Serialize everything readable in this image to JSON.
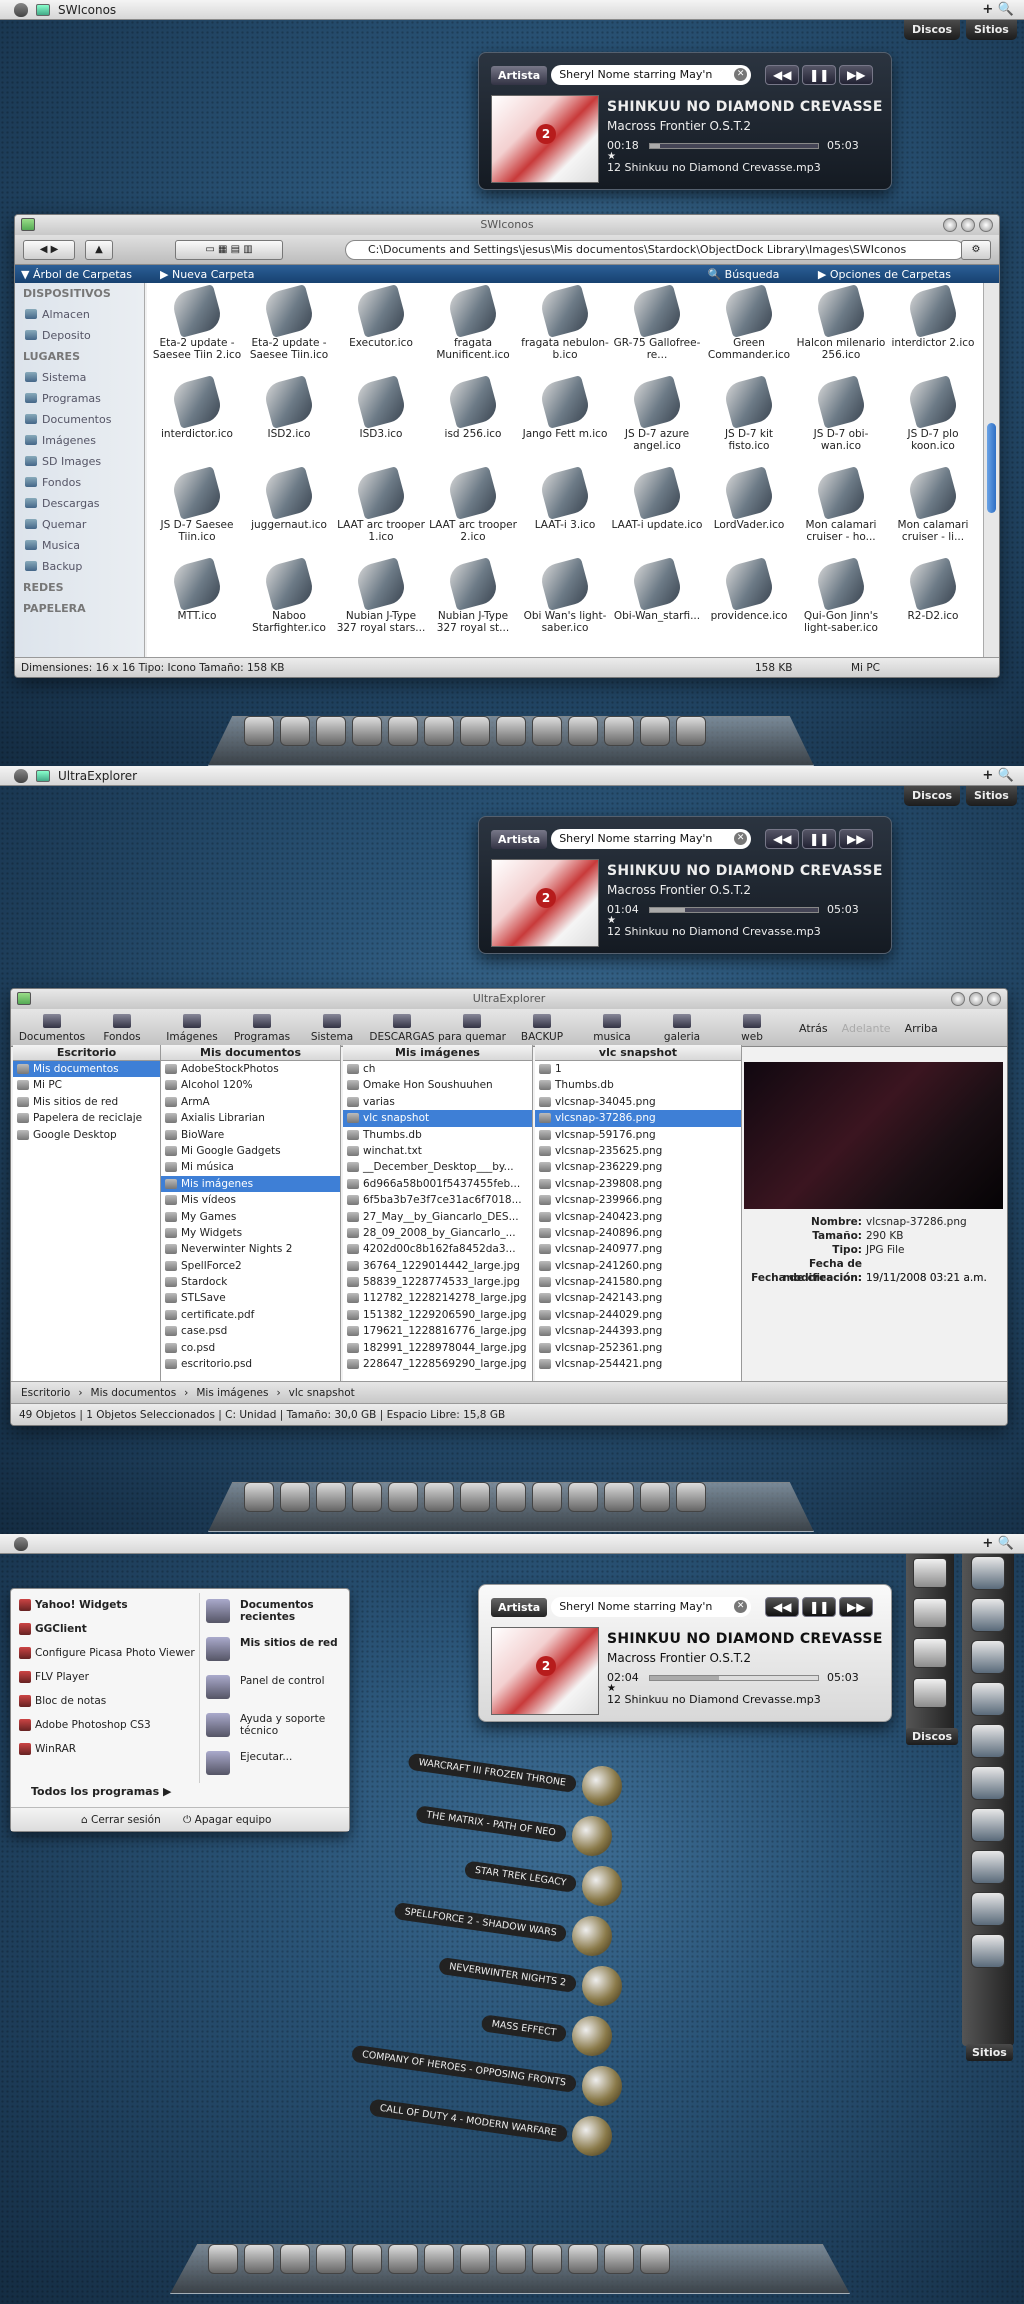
{
  "colors": {
    "accent": "#3e7fd6",
    "ribbon": "#1f4f86",
    "dark_panel": "#1a2029"
  },
  "menubar": {
    "right_icons": "+ 🔍",
    "tab_discos": "Discos",
    "tab_sitios": "Sitios"
  },
  "s1": {
    "title": "SWIconos",
    "player": {
      "artist_btn": "Artista",
      "search": "Sheryl Nome starring May'n",
      "track": "SHINKUU NO DIAMOND CREVASSE",
      "album": "Macross Frontier O.S.T.2",
      "elapsed": "00:18",
      "total": "05:03",
      "progress": 0.06,
      "file": "12 Shinkuu no Diamond Crevasse.mp3"
    },
    "window": {
      "title": "SWIconos",
      "address": "C:\\Documents and Settings\\jesus\\Mis documentos\\Stardock\\ObjectDock Library\\Images\\SWIconos",
      "ribbon": [
        "Árbol de Carpetas",
        "Nueva Carpeta"
      ],
      "ribbon_right": [
        "Búsqueda",
        "Opciones de Carpetas"
      ],
      "sidebar_dispositivos": "DISPOSITIVOS",
      "sidebar_dev": [
        "Almacen",
        "Deposito"
      ],
      "sidebar_lugares": "LUGARES",
      "sidebar_places": [
        "Sistema",
        "Programas",
        "Documentos",
        "Imágenes",
        "SD Images",
        "Fondos",
        "Descargas",
        "Quemar",
        "Musica",
        "Backup"
      ],
      "sidebar_redes": "REDES",
      "sidebar_papelera": "PAPELERA",
      "icons": [
        "Eta-2 update - Saesee Tiin 2.ico",
        "Eta-2 update - Saesee Tiin.ico",
        "Executor.ico",
        "fragata Munificent.ico",
        "fragata nebulon-b.ico",
        "GR-75 Gallofree-re...",
        "Green Commander.ico",
        "Halcon milenario 256.ico",
        "interdictor 2.ico",
        "interdictor.ico",
        "ISD2.ico",
        "ISD3.ico",
        "isd 256.ico",
        "Jango Fett m.ico",
        "JS D-7 azure angel.ico",
        "JS D-7 kit fisto.ico",
        "JS D-7 obi-wan.ico",
        "JS D-7 plo koon.ico",
        "JS D-7 Saesee Tiin.ico",
        "juggernaut.ico",
        "LAAT arc trooper 1.ico",
        "LAAT arc trooper 2.ico",
        "LAAT-i 3.ico",
        "LAAT-i update.ico",
        "LordVader.ico",
        "Mon calamari cruiser - ho...",
        "Mon calamari cruiser - li...",
        "MTT.ico",
        "Naboo Starfighter.ico",
        "Nubian J-Type 327 royal stars...",
        "Nubian J-Type 327 royal st...",
        "Obi Wan's light-saber.ico",
        "Obi-Wan_starfi...",
        "providence.ico",
        "Qui-Gon Jinn's light-saber.ico",
        "R2-D2.ico"
      ],
      "status_left": "Dimensiones: 16 x 16 Tipo: Icono Tamaño: 158 KB",
      "status_size": "158 KB",
      "status_pc": "Mi PC"
    }
  },
  "s2": {
    "title": "UltraExplorer",
    "player": {
      "artist_btn": "Artista",
      "search": "Sheryl Nome starring May'n",
      "track": "SHINKUU NO DIAMOND CREVASSE",
      "album": "Macross Frontier O.S.T.2",
      "elapsed": "01:04",
      "total": "05:03",
      "progress": 0.21,
      "file": "12 Shinkuu no Diamond Crevasse.mp3"
    },
    "window": {
      "title": "UltraExplorer",
      "toolbar": [
        "Documentos",
        "Fondos",
        "Imágenes",
        "Programas",
        "Sistema",
        "DESCARGAS",
        "para quemar",
        "BACKUP",
        "musica",
        "galeria",
        "web"
      ],
      "nav": [
        "Atrás",
        "Adelante",
        "Arriba"
      ],
      "col1_head": "Escritorio",
      "col1": [
        "Mis documentos",
        "Mi PC",
        "Mis sitios de red",
        "Papelera de reciclaje",
        "Google Desktop"
      ],
      "col2_head": "Mis documentos",
      "col2": [
        "AdobeStockPhotos",
        "Alcohol 120%",
        "ArmA",
        "Axialis Librarian",
        "BioWare",
        "Mi Google Gadgets",
        "Mi música",
        "Mis imágenes",
        "Mis vídeos",
        "My Games",
        "My Widgets",
        "Neverwinter Nights 2",
        "SpellForce2",
        "Stardock",
        "STLSave",
        "certificate.pdf",
        "case.psd",
        "co.psd",
        "escritorio.psd"
      ],
      "col3_head": "Mis imágenes",
      "col3": [
        "ch",
        "Omake Hon Soushuuhen",
        "varias",
        "vlc snapshot",
        "Thumbs.db",
        "winchat.txt",
        "__December_Desktop___by...",
        "6d966a58b001f5437455feb...",
        "6f5ba3b7e3f7ce31ac6f7018...",
        "27_May__by_Giancarlo_DES...",
        "28_09_2008_by_Giancarlo_...",
        "4202d00c8b162fa8452da3...",
        "36764_1229014442_large.jpg",
        "58839_1228774533_large.jpg",
        "112782_1228214278_large.jpg",
        "151382_1229206590_large.jpg",
        "179621_1228816776_large.jpg",
        "182991_1228978044_large.jpg",
        "228647_1228569290_large.jpg"
      ],
      "col4_head": "vlc snapshot",
      "col4": [
        "1",
        "Thumbs.db",
        "vlcsnap-34045.png",
        "vlcsnap-37286.png",
        "vlcsnap-59176.png",
        "vlcsnap-235625.png",
        "vlcsnap-236229.png",
        "vlcsnap-239808.png",
        "vlcsnap-239966.png",
        "vlcsnap-240423.png",
        "vlcsnap-240896.png",
        "vlcsnap-240977.png",
        "vlcsnap-241260.png",
        "vlcsnap-241580.png",
        "vlcsnap-242143.png",
        "vlcsnap-244029.png",
        "vlcsnap-244393.png",
        "vlcsnap-252361.png",
        "vlcsnap-254421.png"
      ],
      "props": [
        {
          "k": "Nombre:",
          "v": "vlcsnap-37286.png"
        },
        {
          "k": "Tamaño:",
          "v": "290 KB"
        },
        {
          "k": "Tipo:",
          "v": "JPG File"
        },
        {
          "k": "Fecha de modificación:",
          "v": "19/11/2008 03:21 a.m."
        },
        {
          "k": "Fecha de creación:",
          "v": "19/11/2008 03:21 a.m."
        }
      ],
      "breadcrumb": [
        "Escritorio",
        "Mis documentos",
        "Mis imágenes",
        "vlc snapshot"
      ],
      "status": "49 Objetos  |  1 Objetos Seleccionados  |  C: Unidad  |  Tamaño: 30,0 GB  |  Espacio Libre: 15,8 GB"
    }
  },
  "s3": {
    "player": {
      "artist_btn": "Artista",
      "search": "Sheryl Nome starring May'n",
      "track": "SHINKUU NO DIAMOND CREVASSE",
      "album": "Macross Frontier O.S.T.2",
      "elapsed": "02:04",
      "total": "05:03",
      "progress": 0.41,
      "file": "12 Shinkuu no Diamond Crevasse.mp3"
    },
    "start_left": [
      "Yahoo! Widgets",
      "GGClient",
      "Configure Picasa Photo Viewer",
      "FLV Player",
      "Bloc de notas",
      "Adobe Photoshop CS3",
      "WinRAR"
    ],
    "all_programs": "Todos los programas",
    "start_right": [
      "Documentos recientes",
      "Mis sitios de red",
      "Panel de control",
      "Ayuda y soporte técnico",
      "Ejecutar..."
    ],
    "logout": "Cerrar sesión",
    "shutdown": "Apagar equipo",
    "games": [
      "WARCRAFT III FROZEN THRONE",
      "THE MATRIX - PATH OF NEO",
      "STAR TREK LEGACY",
      "SPELLFORCE 2 - SHADOW WARS",
      "NEVERWINTER NIGHTS 2",
      "MASS EFFECT",
      "COMPANY OF HEROES - OPPOSING FRONTS",
      "CALL OF DUTY 4 - MODERN WARFARE"
    ],
    "discos": "Discos",
    "sitios": "Sitios"
  }
}
